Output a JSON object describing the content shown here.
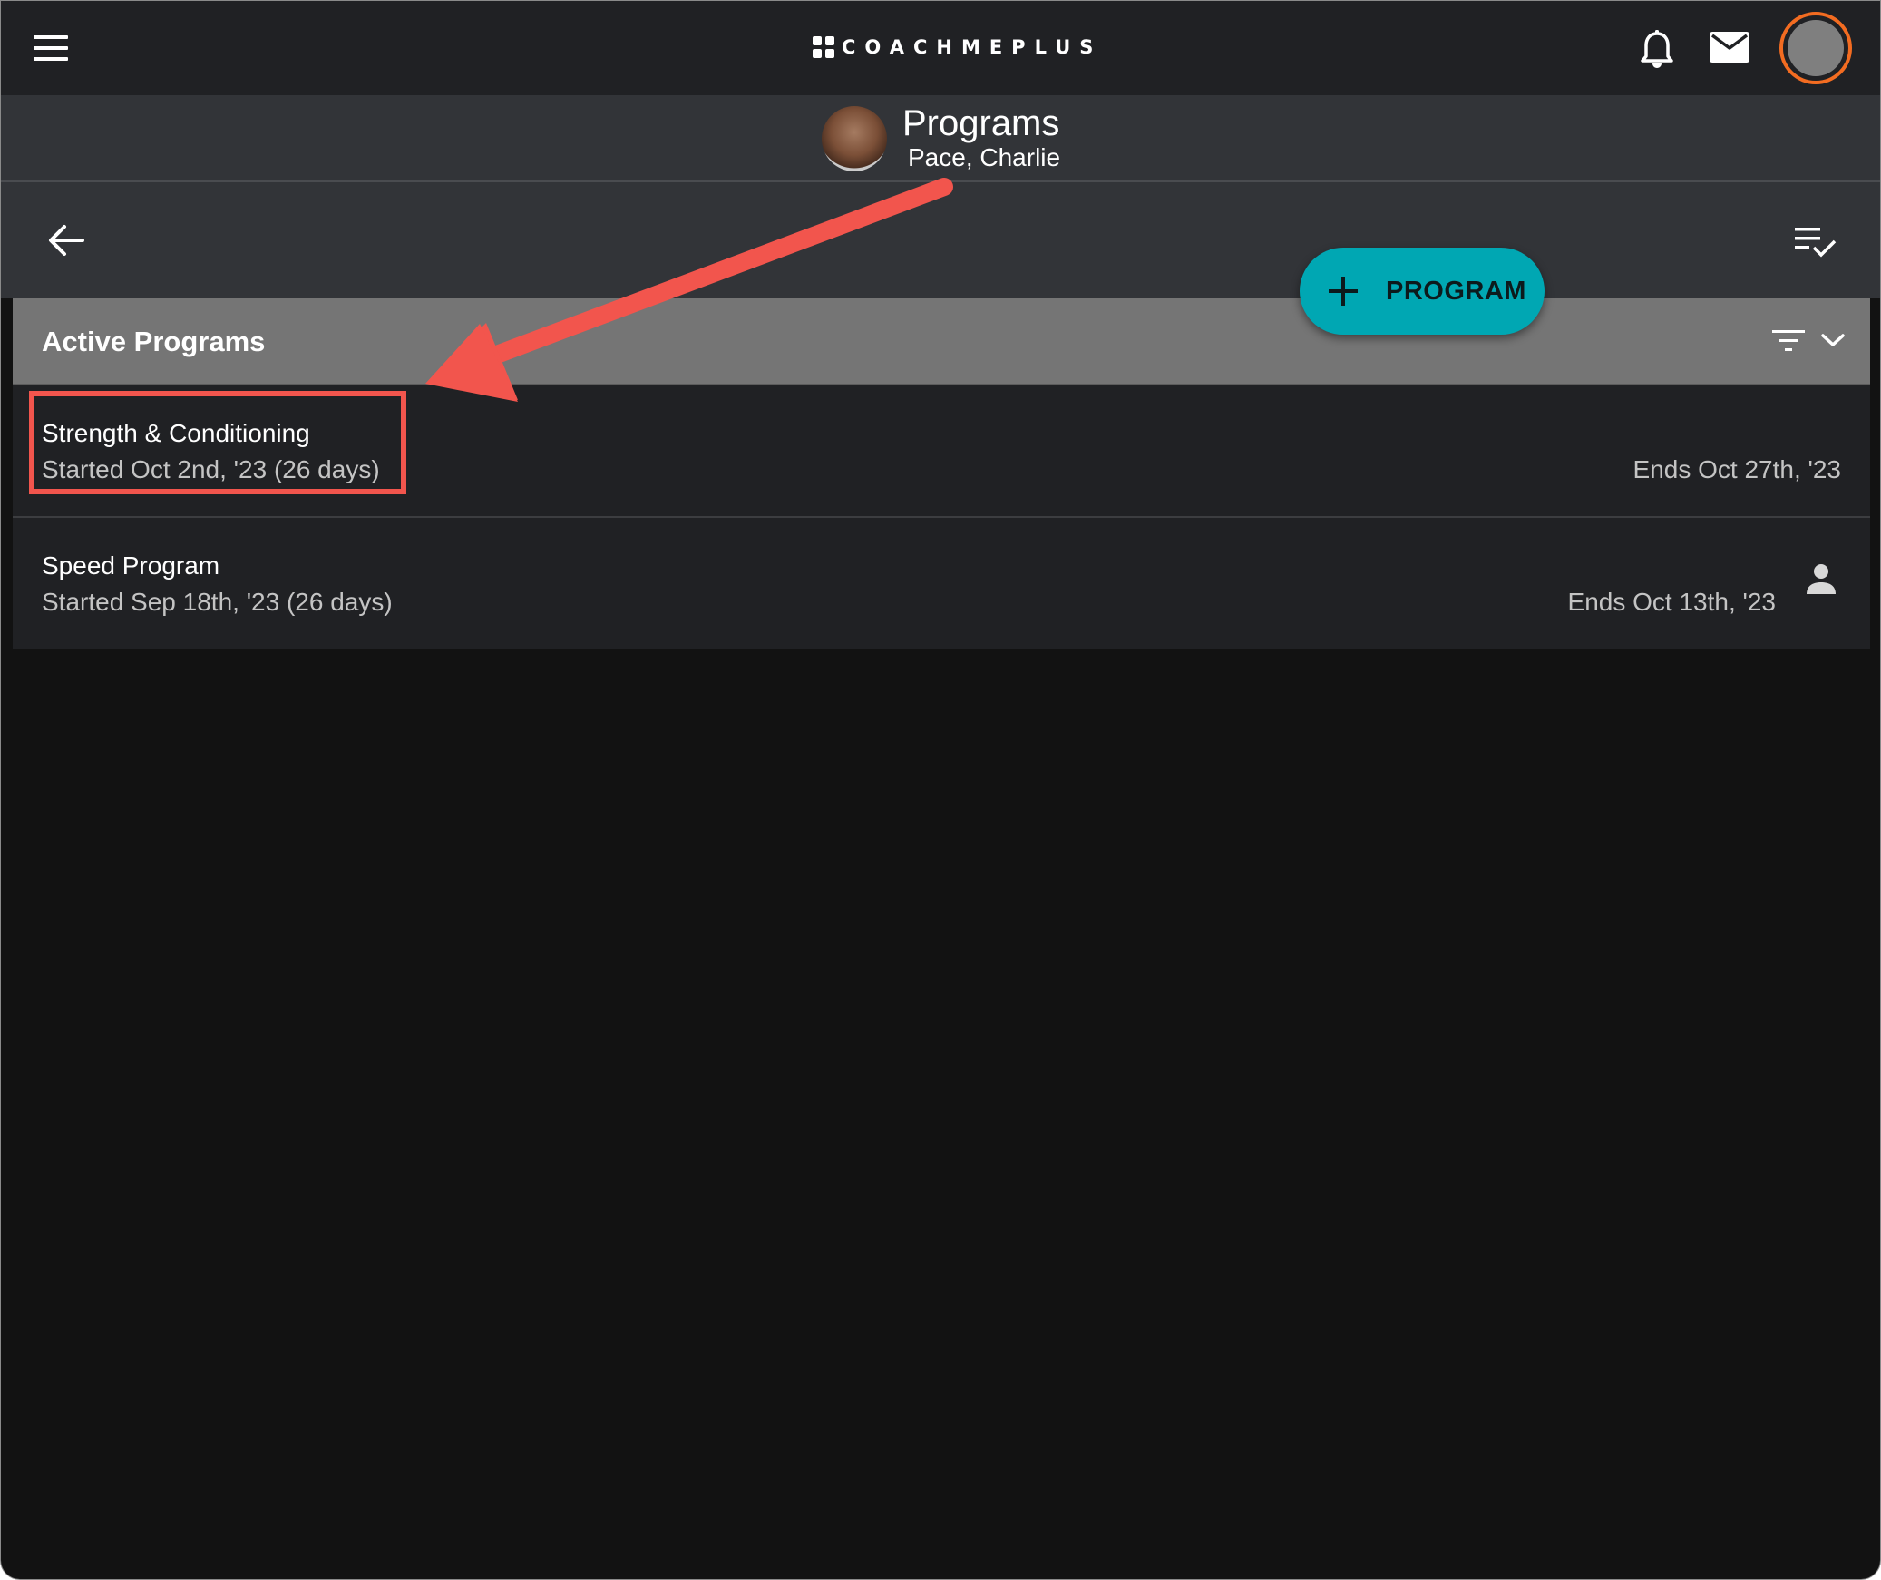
{
  "app": {
    "logo_text": "COACHMEPLUS"
  },
  "header": {
    "title": "Programs",
    "subtitle": "Pace, Charlie"
  },
  "icons": {
    "menu": "menu-icon",
    "notifications": "bell-icon",
    "messages": "mail-icon",
    "user": "avatar",
    "back": "arrow-left-icon",
    "checklist": "playlist-check-icon",
    "sort": "sort-icon",
    "expand": "chevron-down-icon",
    "assigned": "person-icon",
    "add": "plus-icon"
  },
  "fab": {
    "label": "PROGRAM"
  },
  "panel": {
    "title": "Active Programs",
    "programs": [
      {
        "name": "Strength & Conditioning",
        "started": "Started Oct 2nd, '23 (26 days)",
        "ends": "Ends Oct 27th, '23"
      },
      {
        "name": "Speed Program",
        "started": "Started Sep 18th, '23 (26 days)",
        "ends": "Ends Oct 13th, '23"
      }
    ]
  },
  "colors": {
    "accent": "#00a7b3",
    "annotation": "#f2554d",
    "avatar_ring": "#f36c21",
    "appbar": "#202124",
    "panel_header": "#757575",
    "background": "#121212"
  }
}
